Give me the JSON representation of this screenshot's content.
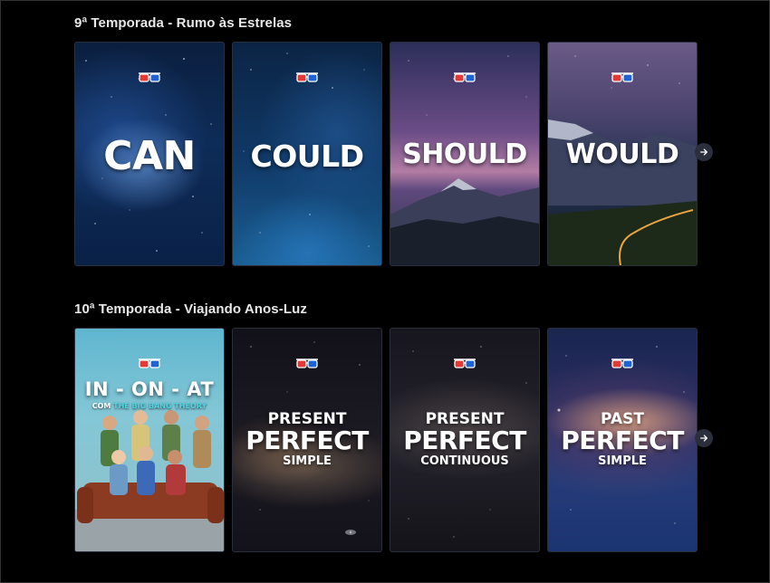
{
  "sections": [
    {
      "title": "9ª Temporada - Rumo às Estrelas",
      "cards": [
        {
          "word": "CAN",
          "icon": "3d-glasses-icon"
        },
        {
          "word": "COULD",
          "icon": "3d-glasses-icon"
        },
        {
          "word": "SHOULD",
          "icon": "3d-glasses-icon"
        },
        {
          "word": "WOULD",
          "icon": "3d-glasses-icon"
        }
      ],
      "next_icon": "arrow-right-icon"
    },
    {
      "title": "10ª Temporada - Viajando Anos-Luz",
      "cards": [
        {
          "title": "IN - ON - AT",
          "subtitle_prefix": "COM",
          "subtitle_highlight": "THE BIG BANG THEORY",
          "icon": "3d-glasses-icon"
        },
        {
          "top": "PRESENT",
          "main": "PERFECT",
          "bottom": "SIMPLE",
          "icon": "3d-glasses-icon"
        },
        {
          "top": "PRESENT",
          "main": "PERFECT",
          "bottom": "CONTINUOUS",
          "icon": "3d-glasses-icon"
        },
        {
          "top": "PAST",
          "main": "PERFECT",
          "bottom": "SIMPLE",
          "icon": "3d-glasses-icon"
        }
      ],
      "next_icon": "arrow-right-icon"
    }
  ],
  "colors": {
    "background": "#000000",
    "title_text": "#e8e8ea",
    "highlight": "#4fd3e0",
    "glasses_red": "#e53935",
    "glasses_blue": "#1e63d6"
  }
}
